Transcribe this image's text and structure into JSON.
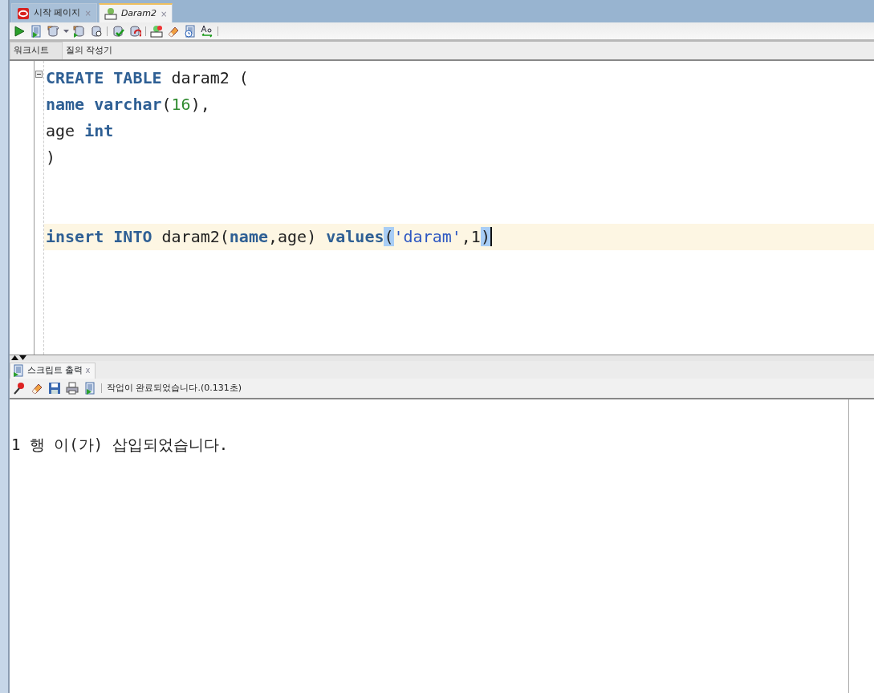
{
  "editor_tabs": [
    {
      "label": "시작 페이지",
      "kind": "start",
      "selected": false,
      "close": "×"
    },
    {
      "label": "Daram2",
      "kind": "sql",
      "selected": true,
      "close": "×"
    }
  ],
  "sub_tabs": [
    {
      "label": "워크시트",
      "selected": true
    },
    {
      "label": "질의 작성기",
      "selected": false
    }
  ],
  "code_lines": [
    {
      "current": false,
      "foldable": true,
      "tokens": [
        {
          "text": "CREATE ",
          "kind": "keyword"
        },
        {
          "text": "TABLE",
          "kind": "keyword"
        },
        {
          "text": " daram2 (",
          "kind": "plain"
        }
      ]
    },
    {
      "current": false,
      "foldable": false,
      "tokens": [
        {
          "text": "name ",
          "kind": "keyword"
        },
        {
          "text": "varchar",
          "kind": "keyword"
        },
        {
          "text": "(",
          "kind": "plain"
        },
        {
          "text": "16",
          "kind": "number"
        },
        {
          "text": "),",
          "kind": "plain"
        }
      ]
    },
    {
      "current": false,
      "foldable": false,
      "tokens": [
        {
          "text": "age ",
          "kind": "plain"
        },
        {
          "text": "int",
          "kind": "keyword"
        }
      ]
    },
    {
      "current": false,
      "foldable": false,
      "tokens": [
        {
          "text": ")",
          "kind": "plain"
        }
      ]
    },
    {
      "current": true,
      "foldable": false,
      "gap_before": true,
      "tokens": [
        {
          "text": "insert ",
          "kind": "keyword"
        },
        {
          "text": "INTO",
          "kind": "keyword"
        },
        {
          "text": " daram2(",
          "kind": "plain"
        },
        {
          "text": "name",
          "kind": "keyword"
        },
        {
          "text": ",age) ",
          "kind": "plain"
        },
        {
          "text": "values",
          "kind": "keyword"
        },
        {
          "text": "(",
          "kind": "match"
        },
        {
          "text": "'daram'",
          "kind": "string"
        },
        {
          "text": ",1",
          "kind": "plain"
        },
        {
          "text": ")",
          "kind": "match"
        }
      ]
    }
  ],
  "output": {
    "tab": {
      "label": "스크립트 출력",
      "close": "x",
      "selected": true
    },
    "status": "작업이 완료되었습니다.(0.131초)",
    "lines": [
      "1 행 이(가) 삽입되었습니다."
    ]
  }
}
